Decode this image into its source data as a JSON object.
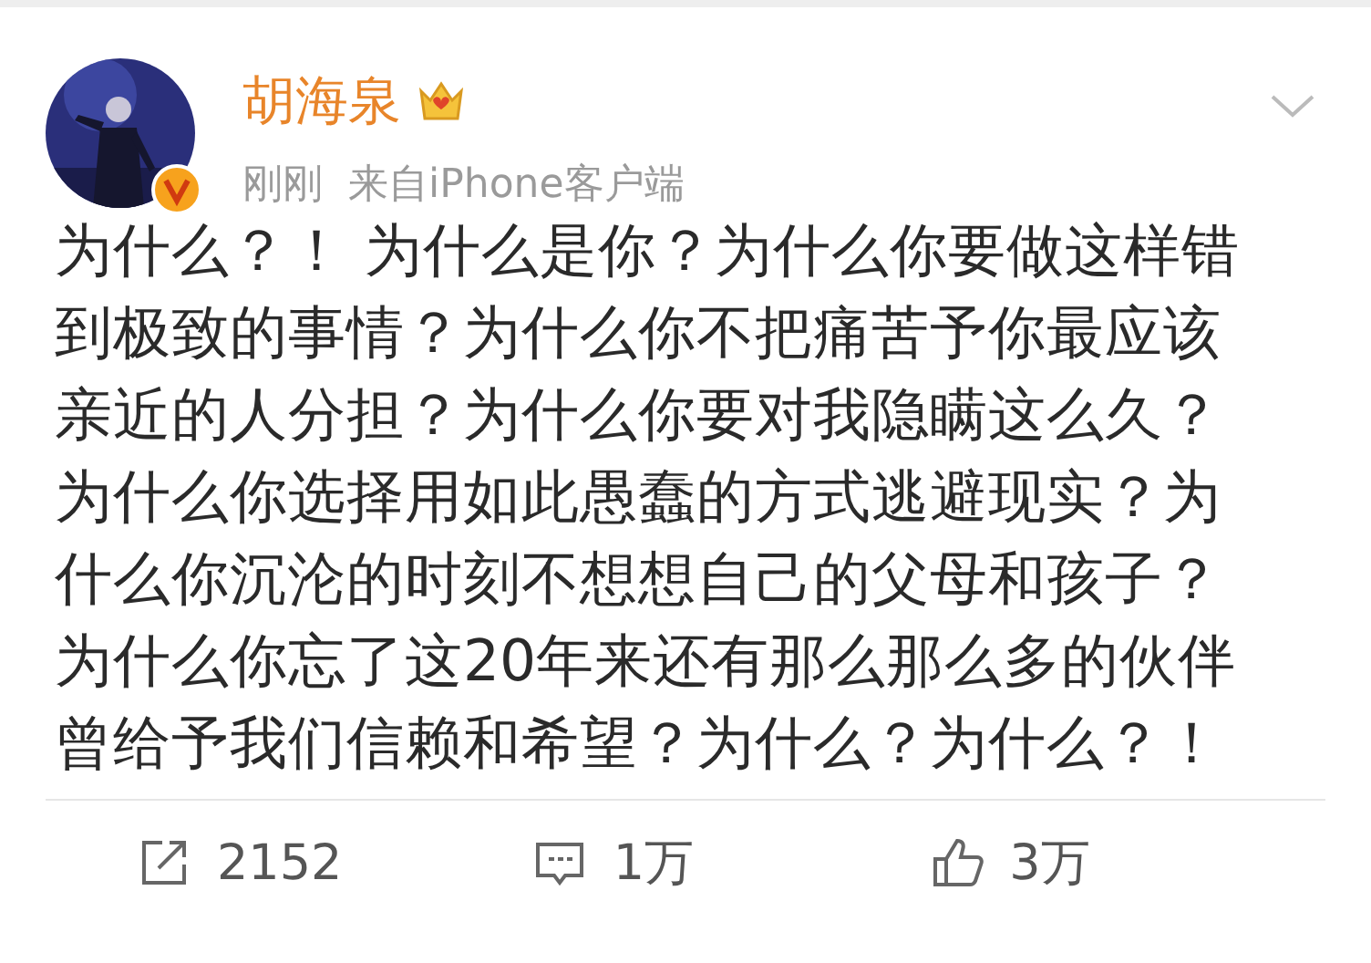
{
  "post": {
    "author": "胡海泉",
    "time": "刚刚",
    "source": "来自iPhone客户端",
    "body_lines": [
      "为什么？！ 为什么是你？为什么你要做这样错",
      "到极致的事情？为什么你不把痛苦予你最应该",
      "亲近的人分担？为什么你要对我隐瞒这么久？",
      "为什么你选择用如此愚蠢的方式逃避现实？为",
      "什么你沉沦的时刻不想想自己的父母和孩子？",
      "为什么你忘了这20年来还有那么那么多的伙伴",
      "曾给予我们信赖和希望？为什么？为什么？！"
    ]
  },
  "actions": [
    {
      "kind": "share",
      "count": "2152"
    },
    {
      "kind": "comment",
      "count": "1万"
    },
    {
      "kind": "like",
      "count": "3万"
    }
  ]
}
